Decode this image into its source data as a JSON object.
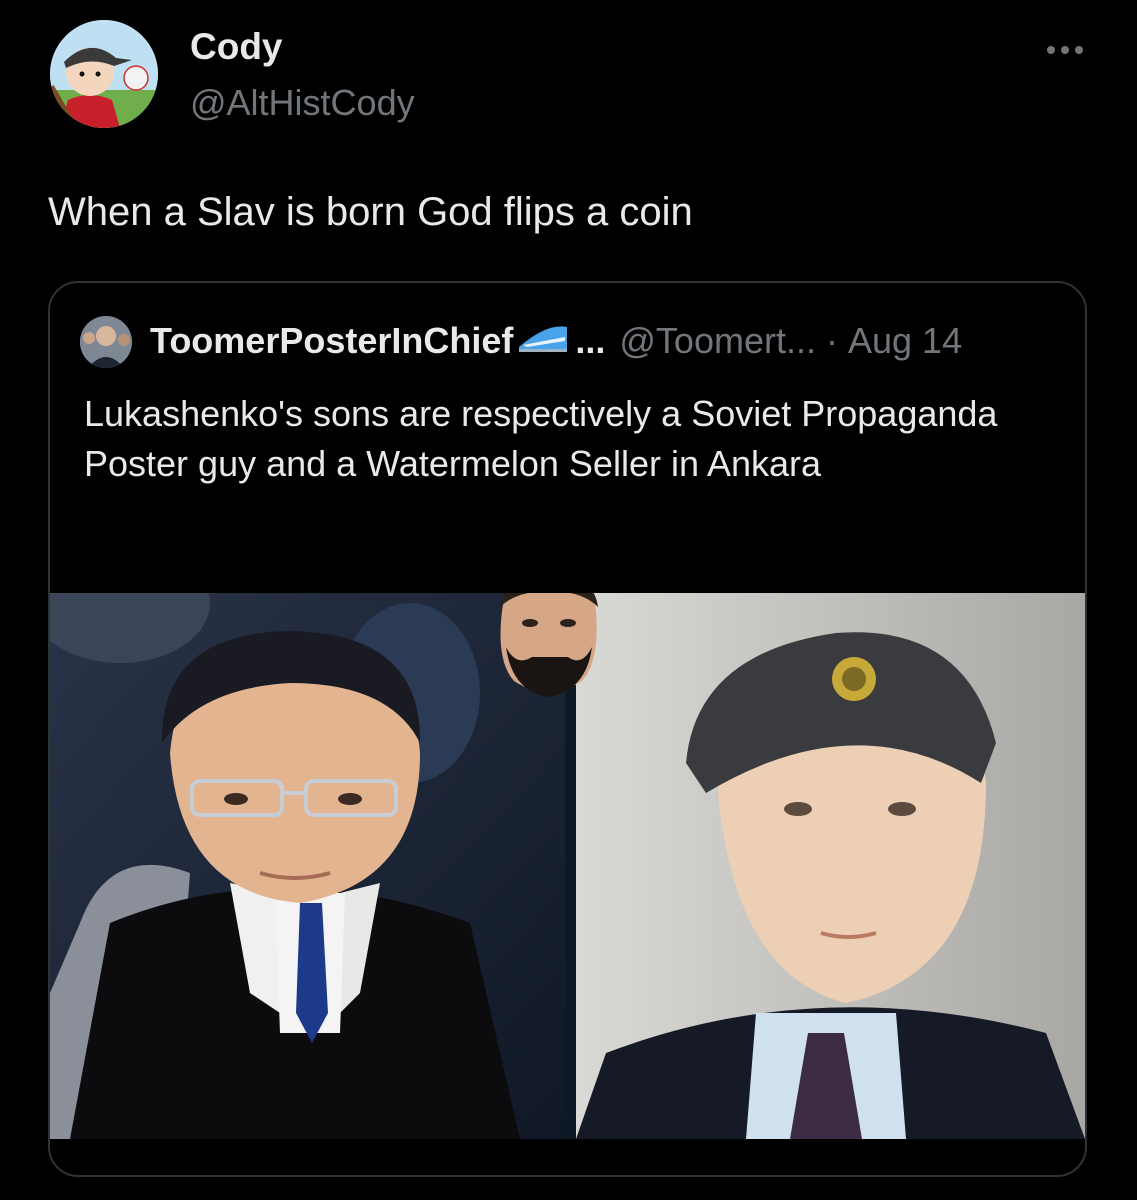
{
  "tweet": {
    "author_name": "Cody",
    "author_handle": "@AltHistCody",
    "more_icon": "more-horizontal-icon",
    "text": "When a Slav is born God flips a coin"
  },
  "quoted": {
    "author_name": "ToomerPosterInChief",
    "name_ellipsis": "...",
    "author_handle": "@Toomert...",
    "separator": "·",
    "date": "Aug 14",
    "text": "Lukashenko's sons are respectively a Soviet Propaganda Poster guy and a Watermelon Seller in Ankara",
    "badge_icon": "train-emoji-icon"
  },
  "colors": {
    "background": "#000000",
    "primary_text": "#e7e9ea",
    "secondary_text": "#71767b",
    "border": "#2f3336"
  }
}
